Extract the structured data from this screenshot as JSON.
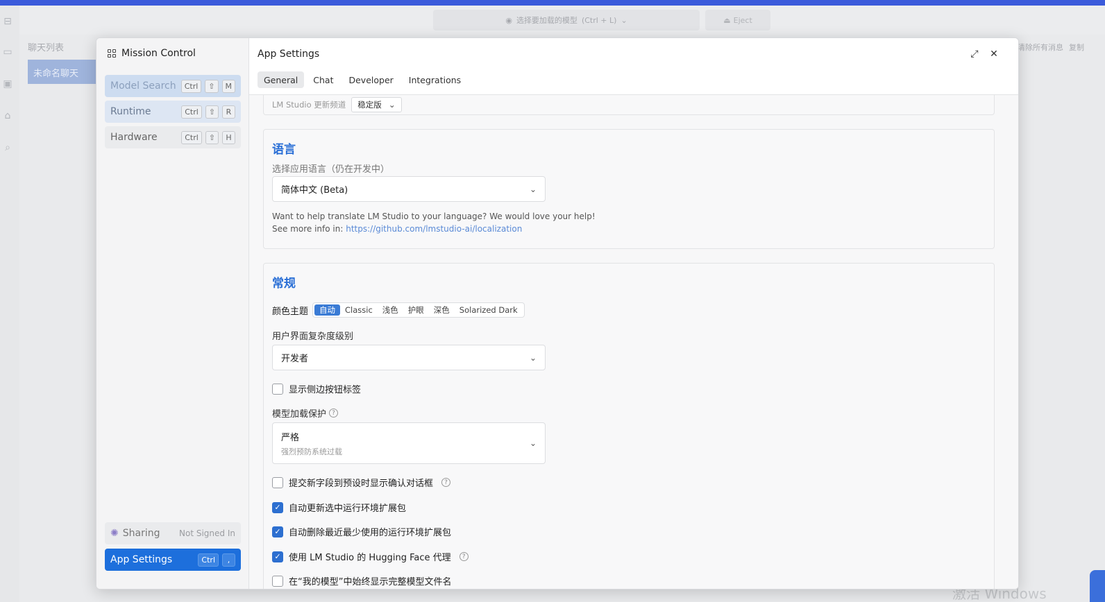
{
  "topbar": {
    "model_picker_text": "选择要加载的模型",
    "model_picker_shortcut": "(Ctrl + L)",
    "eject_label": "Eject"
  },
  "background": {
    "chat_list_title": "聊天列表",
    "chat_item": "未命名聊天",
    "clear_all_messages": "清除所有消息",
    "copy_label": "复制",
    "watermark": "激活 Windows"
  },
  "mission_control": {
    "title": "Mission Control",
    "items": [
      {
        "label": "Model Search",
        "keys": [
          "Ctrl",
          "⇧",
          "M"
        ]
      },
      {
        "label": "Runtime",
        "keys": [
          "Ctrl",
          "⇧",
          "R"
        ]
      },
      {
        "label": "Hardware",
        "keys": [
          "Ctrl",
          "⇧",
          "H"
        ]
      }
    ],
    "sharing": {
      "label": "Sharing",
      "status": "Not Signed In"
    },
    "app_settings": {
      "label": "App Settings",
      "keys": [
        "Ctrl",
        ","
      ]
    }
  },
  "settings": {
    "title": "App Settings",
    "tabs": [
      "General",
      "Chat",
      "Developer",
      "Integrations"
    ],
    "active_tab": "General",
    "update_channel": {
      "label": "LM Studio 更新频道",
      "value": "稳定版"
    },
    "language": {
      "heading": "语言",
      "label": "选择应用语言（仍在开发中）",
      "value": "简体中文 (Beta)",
      "help_line1": "Want to help translate LM Studio to your language? We would love your help!",
      "help_line2_prefix": "See more info in: ",
      "help_link": "https://github.com/lmstudio-ai/localization"
    },
    "general": {
      "heading": "常规",
      "theme_label": "颜色主题",
      "themes": [
        "自动",
        "Classic",
        "浅色",
        "护眼",
        "深色",
        "Solarized Dark"
      ],
      "active_theme": "自动",
      "complexity_label": "用户界面复杂度级别",
      "complexity_value": "开发者",
      "show_sidebar_labels": "显示侧边按钮标签",
      "guardrail_label": "模型加载保护",
      "guardrail_value": "严格",
      "guardrail_sub": "强烈预防系统过载",
      "checks": [
        {
          "label": "提交新字段到预设时显示确认对话框",
          "checked": false,
          "help": true
        },
        {
          "label": "自动更新选中运行环境扩展包",
          "checked": true,
          "help": false
        },
        {
          "label": "自动删除最近最少使用的运行环境扩展包",
          "checked": true,
          "help": false
        },
        {
          "label": "使用 LM Studio 的 Hugging Face 代理",
          "checked": true,
          "help": true
        },
        {
          "label": "在“我的模型”中始终显示完整模型文件名",
          "checked": false,
          "help": false
        }
      ]
    }
  },
  "colors": {
    "accent": "#2d6fd0",
    "heading": "#2a6fd6",
    "app_settings_bg": "#1d6fdc",
    "topstrip": "#3b5bdb"
  }
}
